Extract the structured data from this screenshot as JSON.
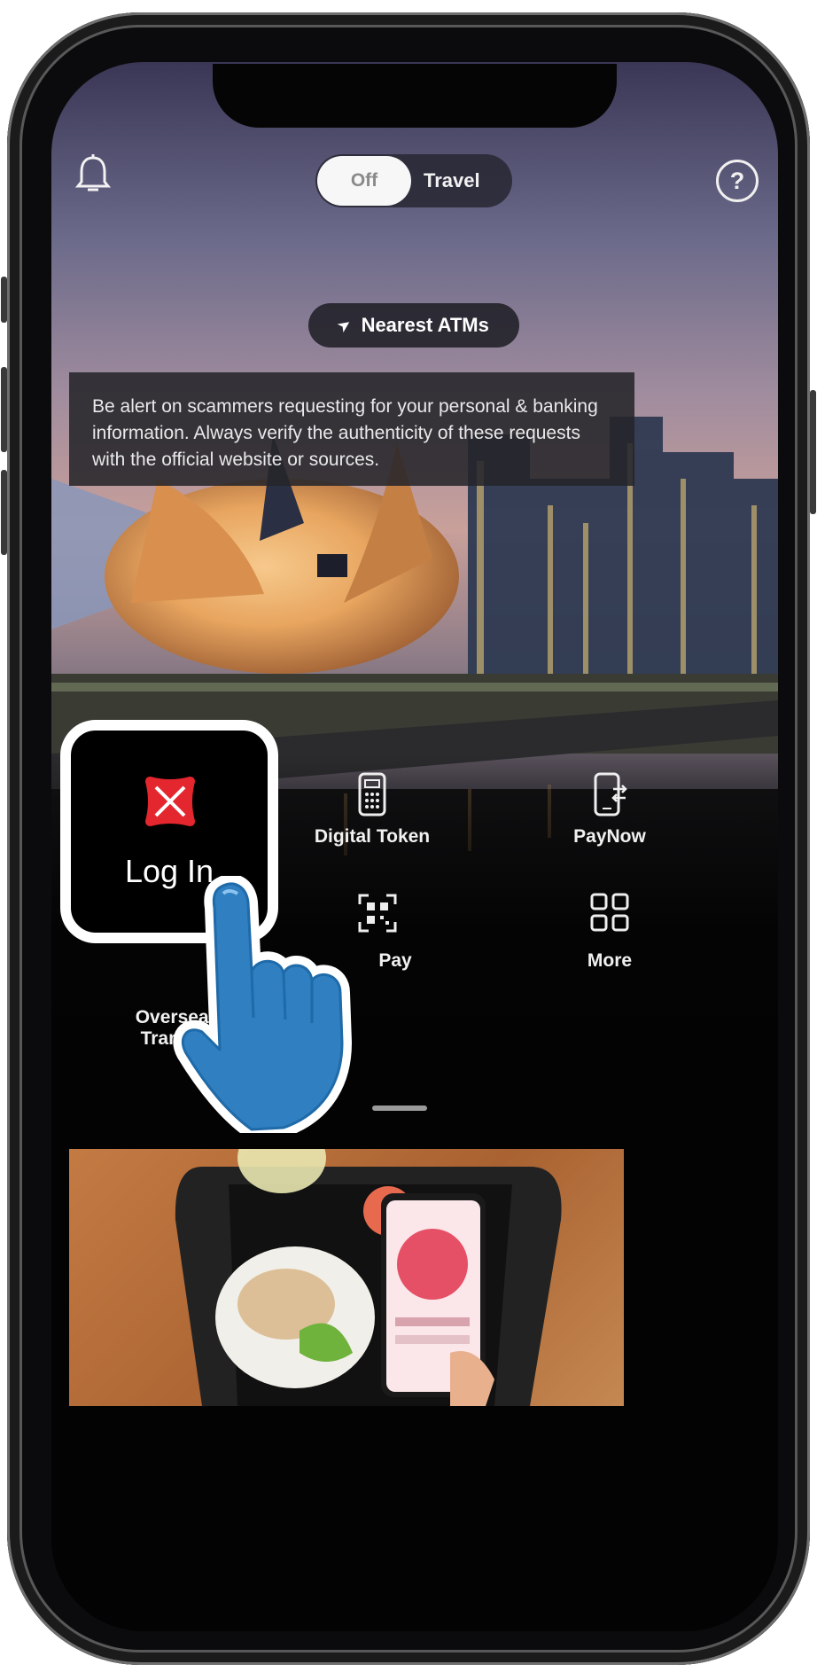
{
  "top_bar": {
    "bell_icon": "bell-icon",
    "mode_toggle": {
      "off_label": "Off",
      "on_label": "Travel"
    },
    "help_icon": "question-mark-icon",
    "help_glyph": "?"
  },
  "nearest_atms": {
    "icon": "location-arrow-icon",
    "arrow_glyph": "➤",
    "label": "Nearest ATMs"
  },
  "notice": {
    "text": "Be alert on scammers requesting for your personal & banking information. Always verify the authenticity of these requests with the official website or sources."
  },
  "quick_actions": {
    "login": {
      "label": "Log In",
      "icon": "dbs-logo-icon"
    },
    "digital_token": {
      "label": "Digital Token",
      "icon": "token-device-icon"
    },
    "paynow": {
      "label": "PayNow",
      "icon": "phone-transfer-icon"
    },
    "overseas_transfer": {
      "label_line1": "Overseas",
      "label_line2": "Transfer",
      "icon": "globe-icon"
    },
    "scan_pay": {
      "label": "Pay",
      "icon": "qr-scan-icon"
    },
    "more": {
      "label": "More",
      "icon": "grid-icon"
    }
  },
  "promo_banner": {
    "image": "food-tray-phone-photo"
  },
  "annotation": {
    "icon": "pointing-hand-icon"
  },
  "colors": {
    "brand_red": "#e4262e",
    "background": "#030303",
    "text": "#f1f1f1"
  }
}
